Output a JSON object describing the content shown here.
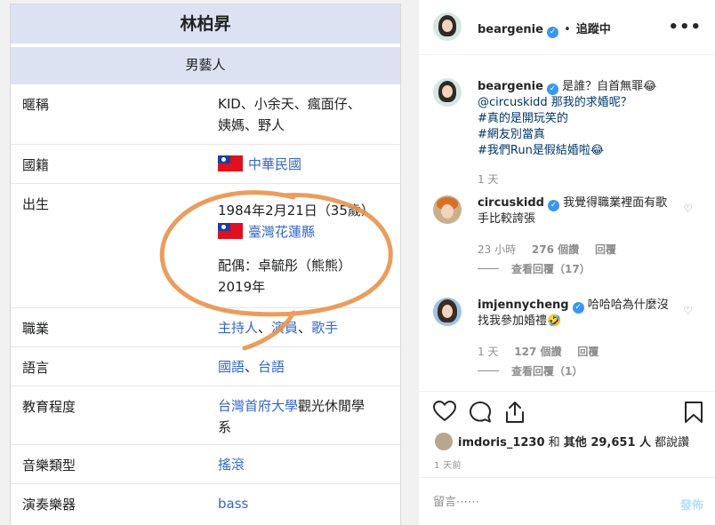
{
  "wiki": {
    "name": "林柏昇",
    "role": "男藝人",
    "rows": {
      "nickname": {
        "key": "暱稱",
        "value_line1": "KID、小余天、瘋面仔、",
        "value_line2": "姨媽、野人"
      },
      "nationality": {
        "key": "國籍",
        "value": "中華民國"
      },
      "birth": {
        "key": "出生",
        "date": "1984年2月21日（35歲）",
        "place": "臺灣花蓮縣",
        "spouse": "配偶：卓毓彤（熊熊）",
        "year": "2019年"
      },
      "occupation": {
        "key": "職業",
        "v1": "主持人",
        "sep1": "、",
        "v2": "演員",
        "sep2": "、",
        "v3": "歌手"
      },
      "language": {
        "key": "語言",
        "v1": "國語",
        "sep": "、",
        "v2": "台語"
      },
      "education": {
        "key": "教育程度",
        "link": "台灣首府大學",
        "rest": "觀光休閒學",
        "rest2": "系"
      },
      "genre": {
        "key": "音樂類型",
        "value": "搖滾"
      },
      "instrument": {
        "key": "演奏樂器",
        "value": "bass"
      }
    }
  },
  "post": {
    "header": {
      "username": "beargenie",
      "dot": "•",
      "follow_status": "追蹤中",
      "more": "•••"
    },
    "caption": {
      "username": "beargenie",
      "line1": "是誰？自首無罪😂",
      "line2": "@circuskidd 那我的求婚呢？",
      "tag1": "#真的是開玩笑的",
      "tag2": "#網友別當真",
      "tag3": "#我們Run是假結婚啦😂",
      "time": "1 天"
    },
    "comments": [
      {
        "username": "circuskidd",
        "text1": "我覺得職業裡面有歌",
        "text2": "手比較誇張",
        "time": "23 小時",
        "likes": "276 個讚",
        "reply": "回覆",
        "view_replies": "查看回覆（17）"
      },
      {
        "username": "imjennycheng",
        "text1": "哈哈哈為什麼沒",
        "text2": "找我參加婚禮🤣",
        "time": "1 天",
        "likes": "127 個讚",
        "reply": "回覆",
        "view_replies": "查看回覆（1）"
      }
    ],
    "likes": {
      "user": "imdoris_1230",
      "and": " 和 ",
      "others": "其他 29,651 人",
      "suffix": " 都說讚"
    },
    "timestamp": "1 天前",
    "compose": {
      "placeholder": "留言⋯⋯",
      "post_label": "發佈"
    }
  },
  "colors": {
    "link": "#3366cc",
    "verified": "#3897f0",
    "hashtag": "#00376b",
    "annotation": "#e8924a"
  }
}
